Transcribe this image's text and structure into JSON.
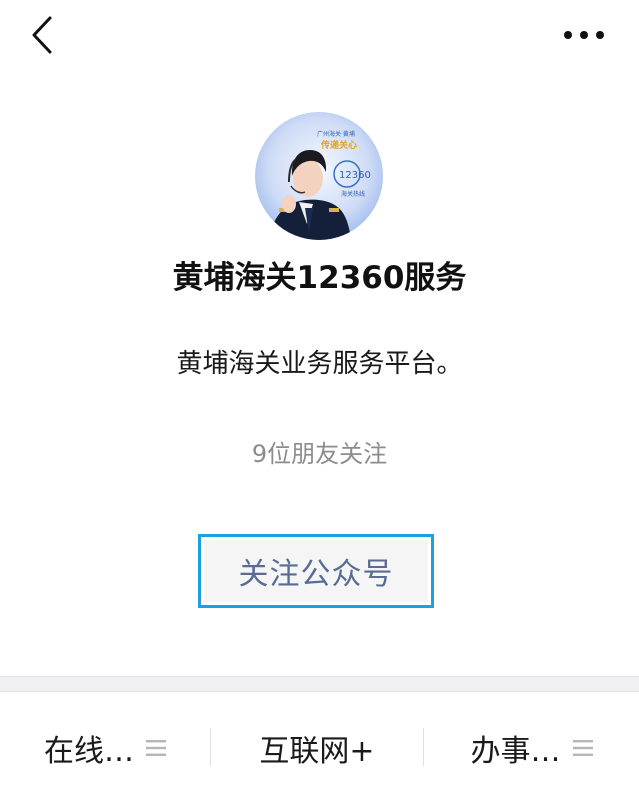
{
  "account": {
    "name": "黄埔海关12360服务",
    "description": "黄埔海关业务服务平台。",
    "followers": "9位朋友关注"
  },
  "actions": {
    "follow_label": "关注公众号"
  },
  "avatar": {
    "badge_line1": "广州海关·黄埔",
    "badge_line2": "传递关心",
    "hotline": "12360",
    "hotline_sub": "海关热线"
  },
  "menu": [
    {
      "label": "在线…",
      "has_submenu": true
    },
    {
      "label": "互联网+",
      "has_submenu": false
    },
    {
      "label": "办事…",
      "has_submenu": true
    }
  ],
  "colors": {
    "follow_text": "#586c94",
    "follow_border": "#1ba1e2",
    "secondary_text": "#8c8c8c",
    "separator": "#efeff4"
  },
  "icons": {
    "back": "chevron-left-icon",
    "more": "more-dots-icon",
    "submenu": "menu-lines-icon"
  }
}
